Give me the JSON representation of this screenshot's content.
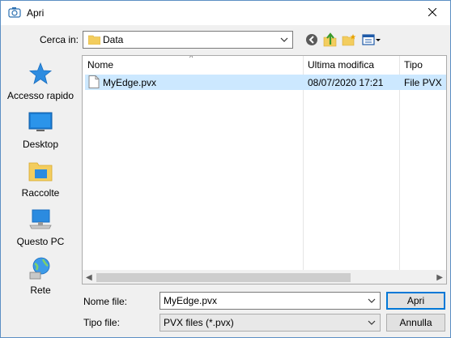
{
  "window": {
    "title": "Apri"
  },
  "toolbar": {
    "look_in_label": "Cerca in:",
    "look_in_value": "Data",
    "icons": [
      "back-arrow-icon",
      "up-folder-icon",
      "new-folder-icon",
      "view-menu-icon"
    ]
  },
  "places": [
    {
      "label": "Accesso rapido",
      "icon": "star-icon"
    },
    {
      "label": "Desktop",
      "icon": "desktop-icon"
    },
    {
      "label": "Raccolte",
      "icon": "libraries-icon"
    },
    {
      "label": "Questo PC",
      "icon": "computer-icon"
    },
    {
      "label": "Rete",
      "icon": "network-icon"
    }
  ],
  "filelist": {
    "columns": [
      "Nome",
      "Ultima modifica",
      "Tipo"
    ],
    "rows": [
      {
        "name": "MyEdge.pvx",
        "modified": "08/07/2020 17:21",
        "type": "File PVX"
      }
    ]
  },
  "footer": {
    "filename_label": "Nome file:",
    "filename_value": "MyEdge.pvx",
    "filetype_label": "Tipo file:",
    "filetype_value": "PVX files (*.pvx)",
    "open_label": "Apri",
    "cancel_label": "Annulla"
  }
}
